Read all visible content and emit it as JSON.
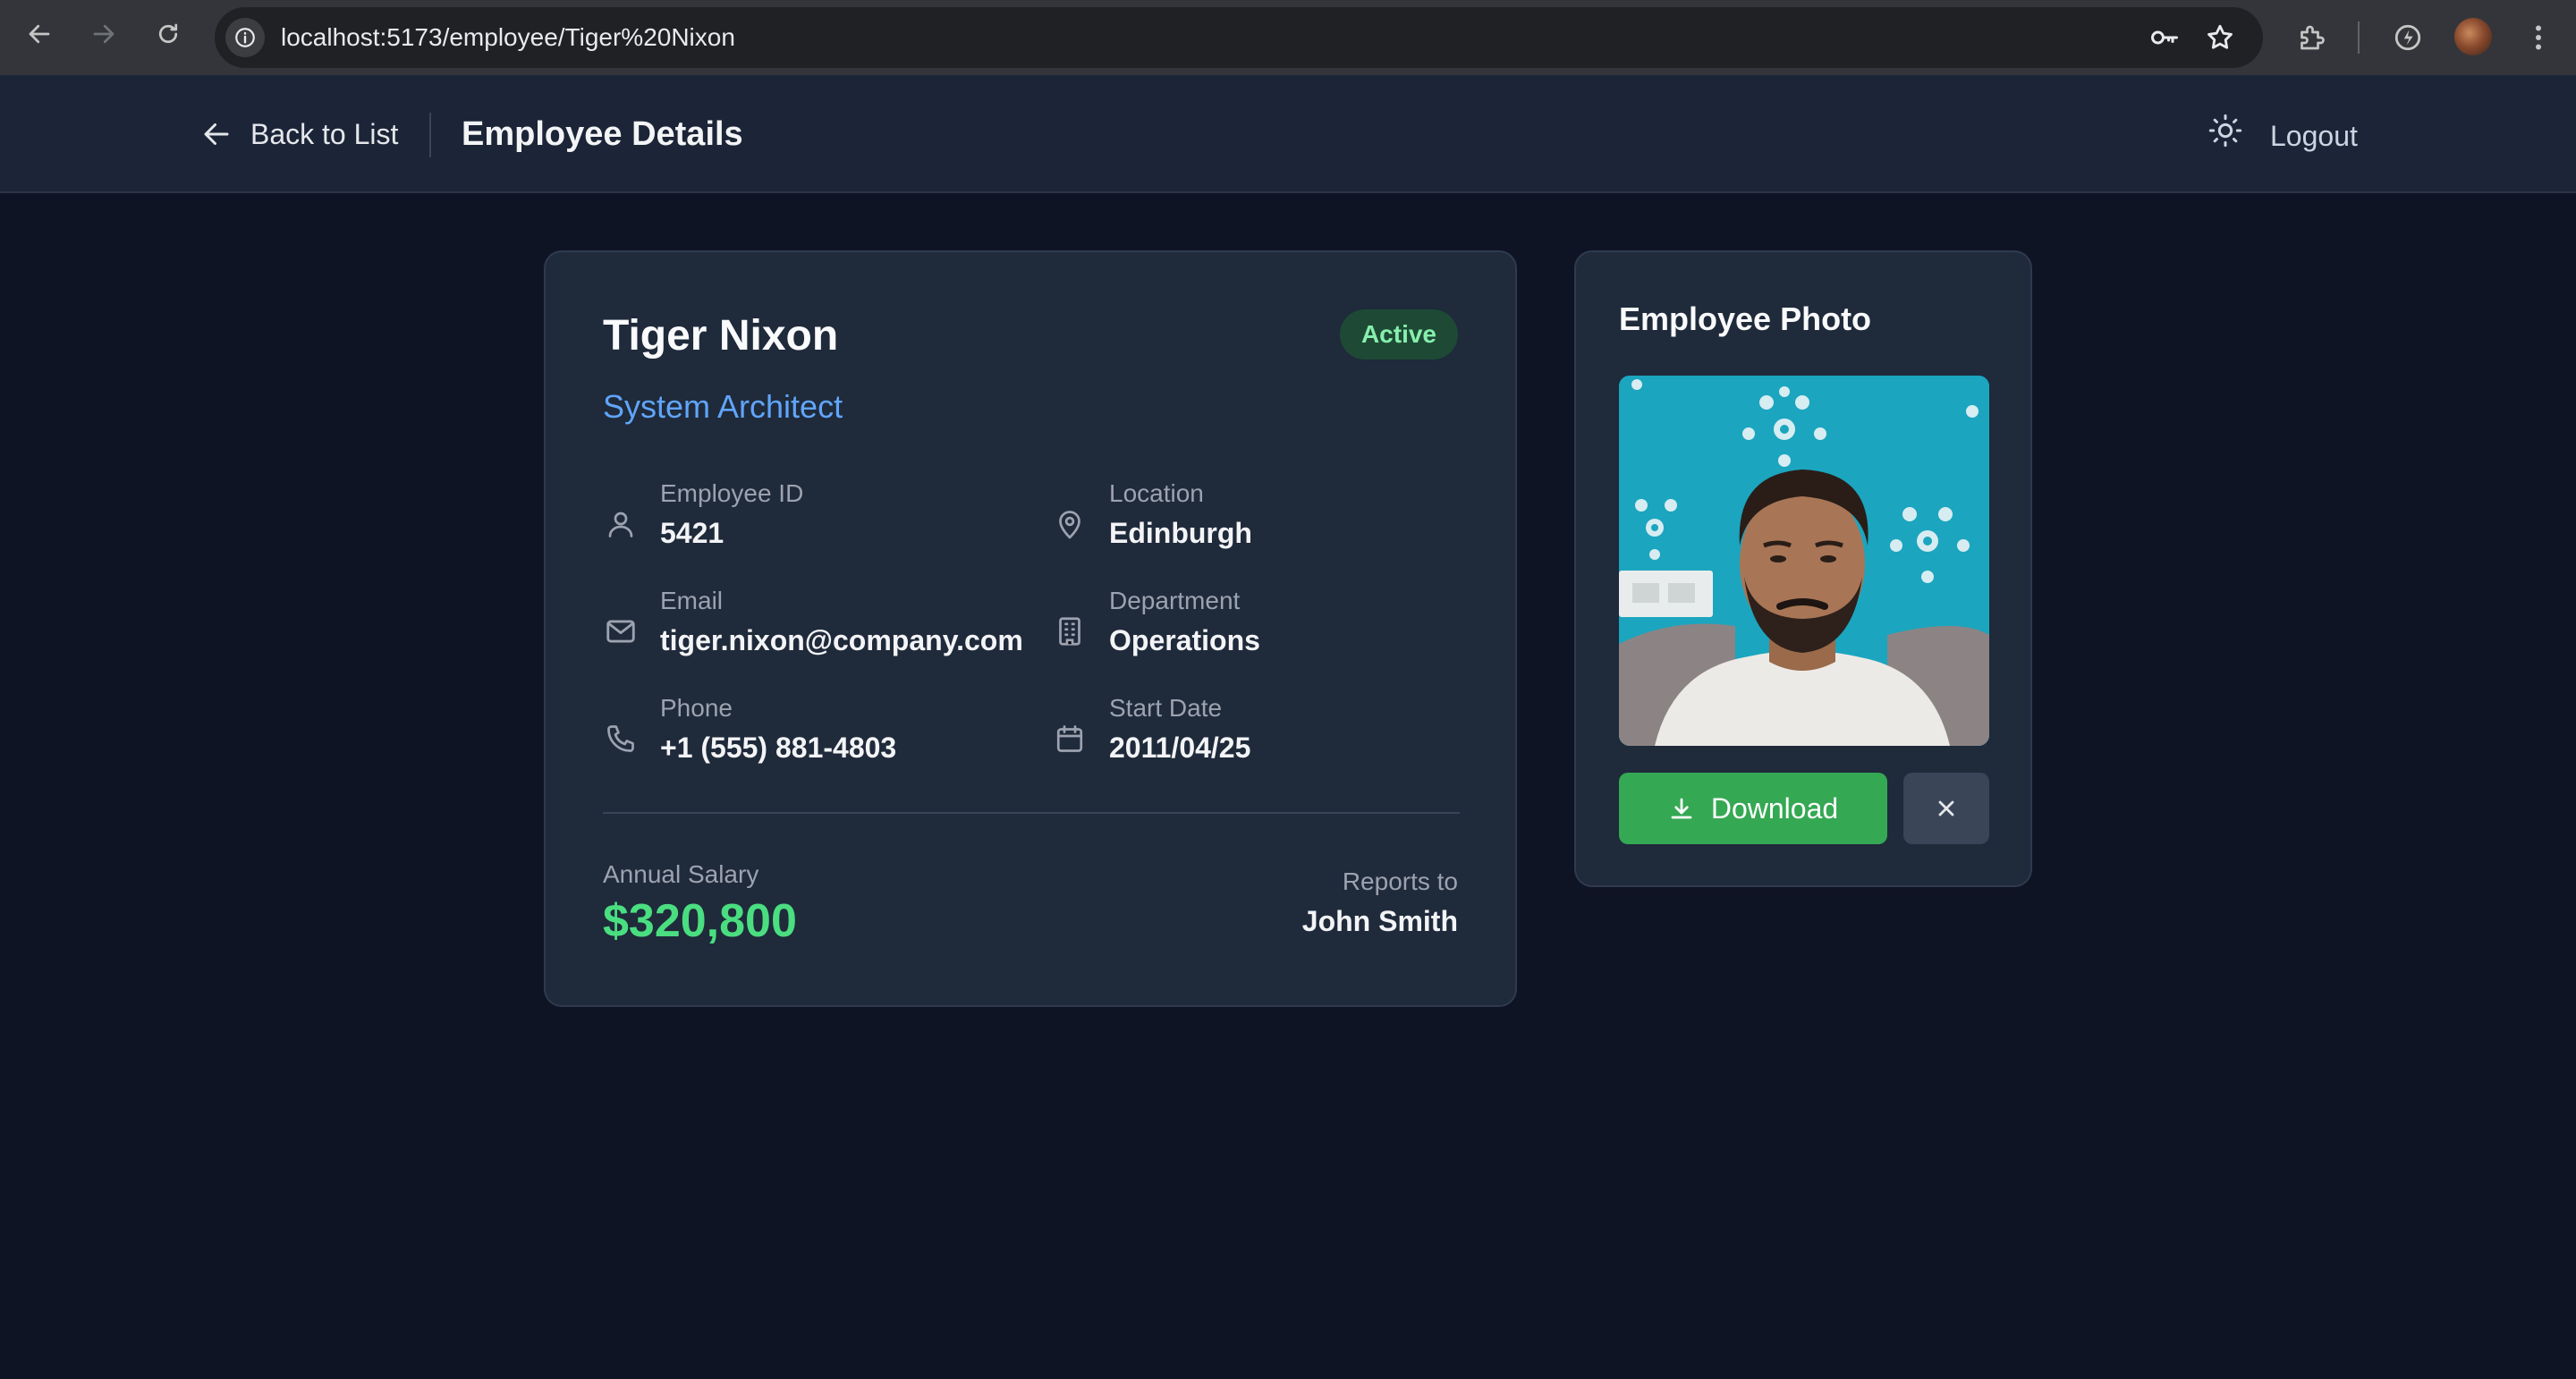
{
  "browser": {
    "url": "localhost:5173/employee/Tiger%20Nixon"
  },
  "header": {
    "back_label": "Back to List",
    "title": "Employee Details",
    "logout_label": "Logout"
  },
  "employee": {
    "name": "Tiger Nixon",
    "title": "System Architect",
    "status": "Active",
    "fields": [
      {
        "label": "Employee ID",
        "value": "5421",
        "icon": "user-icon"
      },
      {
        "label": "Location",
        "value": "Edinburgh",
        "icon": "map-pin-icon"
      },
      {
        "label": "Email",
        "value": "tiger.nixon@company.com",
        "icon": "mail-icon"
      },
      {
        "label": "Department",
        "value": "Operations",
        "icon": "building-icon"
      },
      {
        "label": "Phone",
        "value": "+1 (555) 881-4803",
        "icon": "phone-icon"
      },
      {
        "label": "Start Date",
        "value": "2011/04/25",
        "icon": "calendar-icon"
      }
    ],
    "salary_label": "Annual Salary",
    "salary_value": "$320,800",
    "reports_label": "Reports to",
    "reports_value": "John Smith"
  },
  "photo_panel": {
    "title": "Employee Photo",
    "download_label": "Download"
  },
  "colors": {
    "accent_blue": "#60a5fa",
    "salary_green": "#4ade80",
    "download_green": "#35a853",
    "badge_bg": "#1e4a35",
    "badge_text": "#86efac"
  }
}
